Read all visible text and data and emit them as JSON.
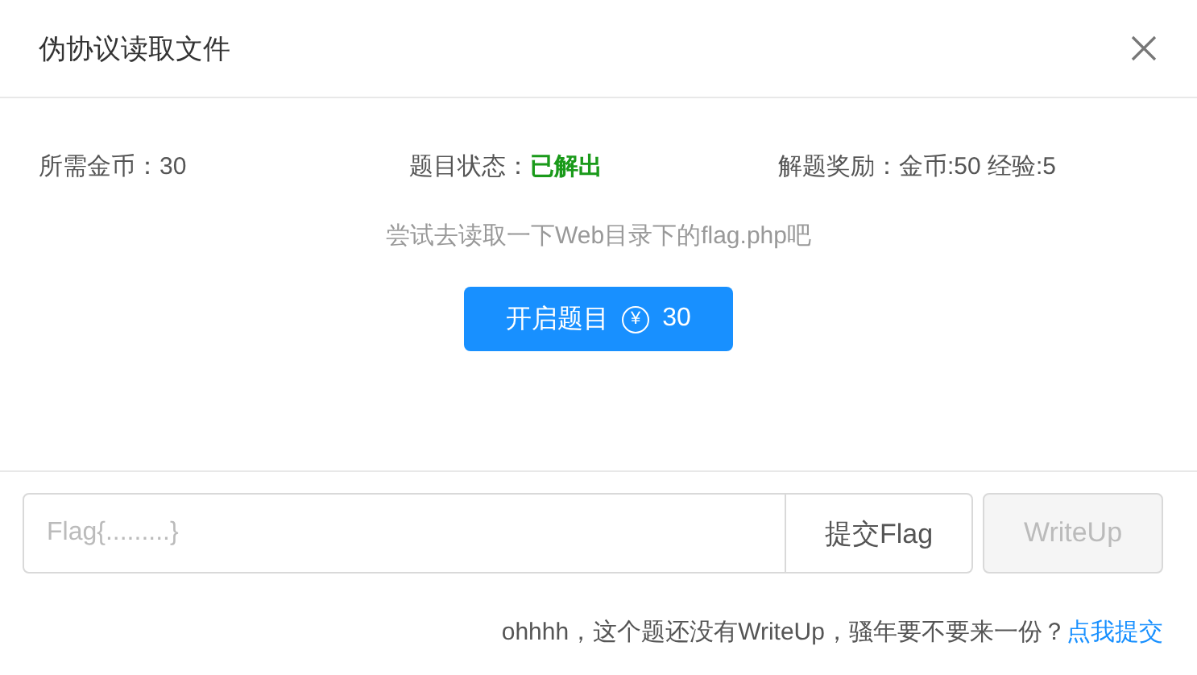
{
  "dialog": {
    "title": "伪协议读取文件"
  },
  "info": [
    {
      "kind": "plain",
      "label": "所需金币：",
      "value": "30"
    },
    {
      "kind": "status",
      "label": "题目状态：",
      "value": "已解出"
    },
    {
      "kind": "plain",
      "label": "解题奖励：",
      "value": "金币:50 经验:5"
    }
  ],
  "hint": "尝试去读取一下Web目录下的flag.php吧",
  "start_button": {
    "label": "开启题目",
    "coin_icon": "¥",
    "cost": "30"
  },
  "flag_input": {
    "placeholder": "Flag{.........}"
  },
  "submit_button": {
    "label": "提交Flag"
  },
  "writeup_button": {
    "label": "WriteUp",
    "disabled": true
  },
  "footer": {
    "text": "ohhhh，这个题还没有WriteUp，骚年要不要来一份？",
    "link": "点我提交"
  }
}
